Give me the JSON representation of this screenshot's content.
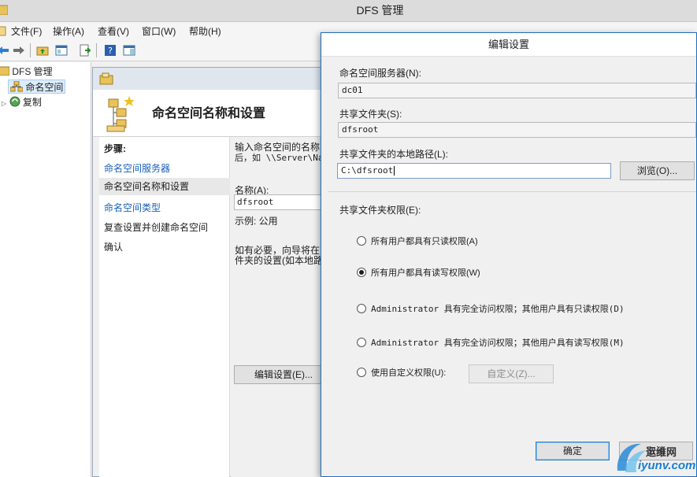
{
  "main_window": {
    "title": "DFS 管理",
    "menu": [
      "文件(F)",
      "操作(A)",
      "查看(V)",
      "窗口(W)",
      "帮助(H)"
    ]
  },
  "tree": {
    "root": "DFS 管理",
    "items": [
      {
        "label": "命名空间",
        "selected": true
      },
      {
        "label": "复制",
        "selected": false
      }
    ]
  },
  "wizard": {
    "heading": "命名空间名称和设置",
    "steps_title": "步骤:",
    "steps": [
      {
        "label": "命名空间服务器",
        "state": "link"
      },
      {
        "label": "命名空间名称和设置",
        "state": "current"
      },
      {
        "label": "命名空间类型",
        "state": "link"
      },
      {
        "label": "复查设置并创建命名空间",
        "state": "plain"
      },
      {
        "label": "确认",
        "state": "plain"
      }
    ],
    "intro_line1": "输入命名空间的名称",
    "intro_line2": "后，如 \\\\Server\\Na",
    "name_label": "名称(A):",
    "name_value": "dfsroot",
    "example": "示例: 公用",
    "note_line1": "如有必要，向导将在",
    "note_line2": "件夹的设置(如本地路",
    "edit_settings_button": "编辑设置(E)..."
  },
  "dialog": {
    "title": "编辑设置",
    "server_label": "命名空间服务器(N):",
    "server_value": "dc01",
    "share_label": "共享文件夹(S):",
    "share_value": "dfsroot",
    "local_path_label": "共享文件夹的本地路径(L):",
    "local_path_value": "C:\\dfsroot",
    "browse_button": "浏览(O)...",
    "permissions_label": "共享文件夹权限(E):",
    "permissions": [
      {
        "label": "所有用户都具有只读权限(A)",
        "checked": false
      },
      {
        "label": "所有用户都具有读写权限(W)",
        "checked": true
      },
      {
        "label": "Administrator 具有完全访问权限；其他用户具有只读权限(D)",
        "checked": false
      },
      {
        "label": "Administrator 具有完全访问权限；其他用户具有读写权限(M)",
        "checked": false
      },
      {
        "label": "使用自定义权限(U):",
        "checked": false
      }
    ],
    "custom_button": "自定义(Z)...",
    "ok_button": "确定",
    "cancel_button": "取消"
  },
  "watermark": {
    "text_top": "运维网",
    "text_bottom": "iyunv.com"
  },
  "colors": {
    "link": "#1a5fb4",
    "dialog_border": "#1a6fc0",
    "selection": "#dcecfc"
  }
}
